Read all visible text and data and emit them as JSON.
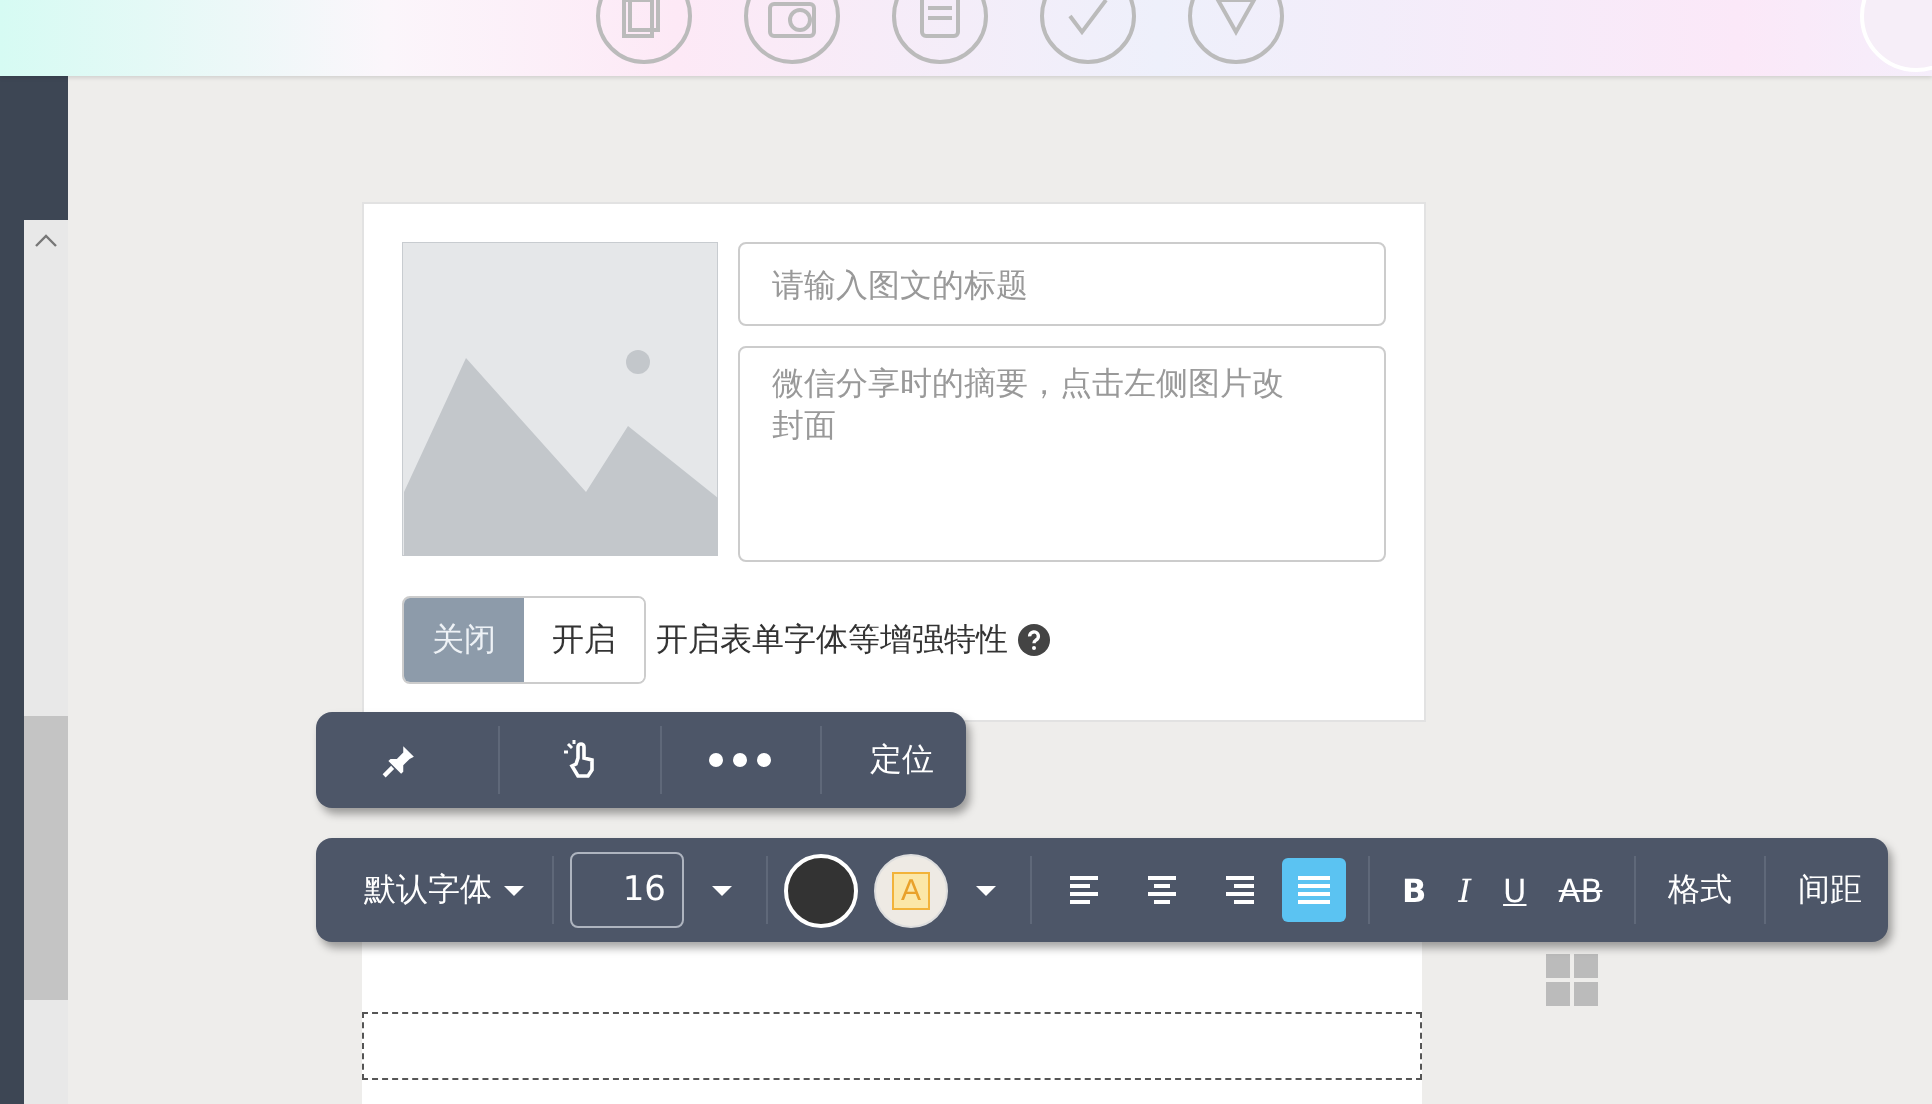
{
  "title_field": {
    "placeholder": "请输入图文的标题"
  },
  "summary_field": {
    "placeholder": "微信分享时的摘要，点击左侧图片改封面"
  },
  "enhance_toggle": {
    "options": [
      {
        "label": "关闭",
        "selected": true
      },
      {
        "label": "开启",
        "selected": false
      }
    ],
    "label": "开启表单字体等增强特性"
  },
  "float_toolbar": {
    "items": [
      {
        "kind": "pin"
      },
      {
        "kind": "pointer"
      },
      {
        "kind": "more"
      },
      {
        "kind": "text",
        "label": "定位"
      }
    ]
  },
  "format_toolbar": {
    "font": "默认字体",
    "font_size": "16",
    "highlight_glyph": "A",
    "align": [
      {
        "kind": "left",
        "selected": false
      },
      {
        "kind": "center",
        "selected": false
      },
      {
        "kind": "right",
        "selected": false
      },
      {
        "kind": "justify",
        "selected": true
      }
    ],
    "styles": [
      {
        "kind": "bold",
        "label": "B"
      },
      {
        "kind": "italic",
        "label": "I"
      },
      {
        "kind": "underline",
        "label": "U"
      },
      {
        "kind": "strike",
        "label": "AB"
      }
    ],
    "menus": [
      "格式",
      "间距"
    ]
  }
}
